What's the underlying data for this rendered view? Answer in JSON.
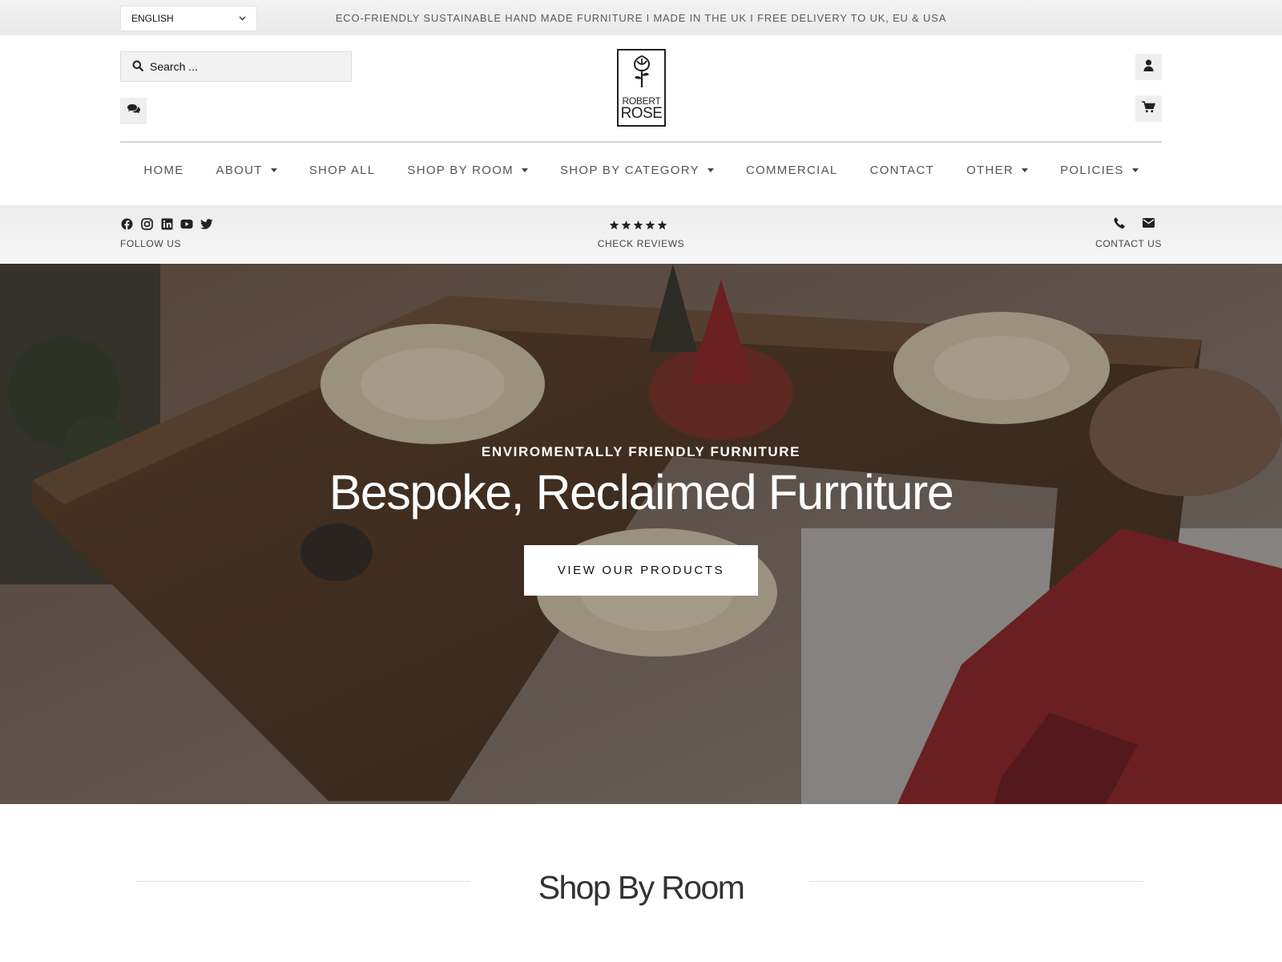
{
  "topbar": {
    "language": "ENGLISH",
    "announcement": "ECO-FRIENDLY SUSTAINABLE HAND MADE FURNITURE I MADE IN THE UK I FREE DELIVERY TO UK, EU & USA"
  },
  "header": {
    "search_placeholder": "Search ...",
    "logo_line1": "ROBERT",
    "logo_line2": "ROSE",
    "icons": [
      "search-icon",
      "chat-icon",
      "rose-logo",
      "user-icon",
      "cart-icon"
    ]
  },
  "nav": {
    "items": [
      {
        "label": "HOME",
        "dropdown": false
      },
      {
        "label": "ABOUT",
        "dropdown": true
      },
      {
        "label": "SHOP ALL",
        "dropdown": false
      },
      {
        "label": "SHOP BY ROOM",
        "dropdown": true
      },
      {
        "label": "SHOP BY CATEGORY",
        "dropdown": true
      },
      {
        "label": "COMMERCIAL",
        "dropdown": false
      },
      {
        "label": "CONTACT",
        "dropdown": false
      },
      {
        "label": "OTHER",
        "dropdown": true
      },
      {
        "label": "POLICIES",
        "dropdown": true
      }
    ]
  },
  "infobar": {
    "follow_label": "FOLLOW US",
    "social_icons": [
      "facebook-icon",
      "instagram-icon",
      "linkedin-icon",
      "youtube-icon",
      "twitter-icon"
    ],
    "reviews_label": "CHECK REVIEWS",
    "rating_stars": 5,
    "contact_label": "CONTACT US",
    "contact_icons": [
      "phone-icon",
      "envelope-icon"
    ]
  },
  "hero": {
    "subtitle": "ENVIROMENTALLY FRIENDLY FURNITURE",
    "title": "Bespoke, Reclaimed Furniture",
    "button": "VIEW OUR PRODUCTS"
  },
  "section": {
    "title": "Shop By Room"
  },
  "colors": {
    "topbar_bg": "#efefef",
    "text_dark": "#222222",
    "nav_text": "#555555",
    "hero_overlay": "#28221e"
  }
}
